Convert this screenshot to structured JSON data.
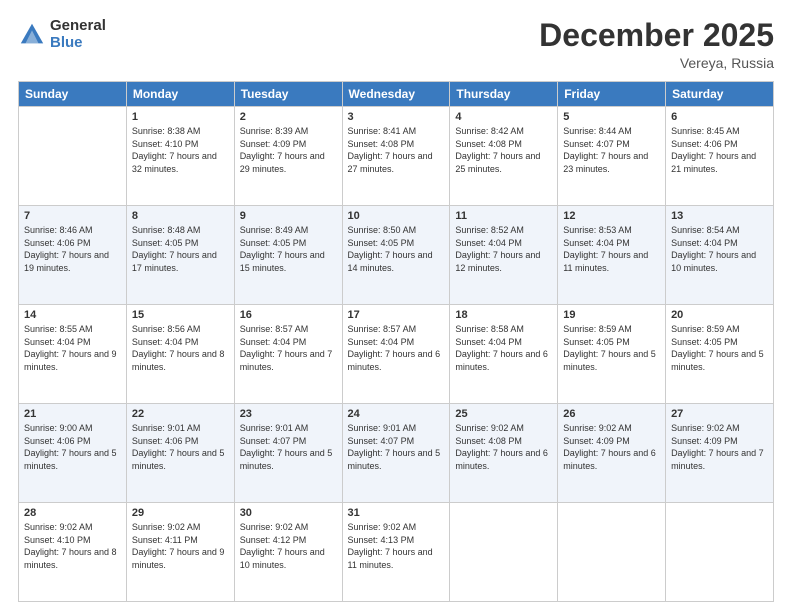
{
  "logo": {
    "general": "General",
    "blue": "Blue"
  },
  "title": "December 2025",
  "location": "Vereya, Russia",
  "days_header": [
    "Sunday",
    "Monday",
    "Tuesday",
    "Wednesday",
    "Thursday",
    "Friday",
    "Saturday"
  ],
  "weeks": [
    [
      {
        "num": "",
        "sunrise": "",
        "sunset": "",
        "daylight": ""
      },
      {
        "num": "1",
        "sunrise": "Sunrise: 8:38 AM",
        "sunset": "Sunset: 4:10 PM",
        "daylight": "Daylight: 7 hours and 32 minutes."
      },
      {
        "num": "2",
        "sunrise": "Sunrise: 8:39 AM",
        "sunset": "Sunset: 4:09 PM",
        "daylight": "Daylight: 7 hours and 29 minutes."
      },
      {
        "num": "3",
        "sunrise": "Sunrise: 8:41 AM",
        "sunset": "Sunset: 4:08 PM",
        "daylight": "Daylight: 7 hours and 27 minutes."
      },
      {
        "num": "4",
        "sunrise": "Sunrise: 8:42 AM",
        "sunset": "Sunset: 4:08 PM",
        "daylight": "Daylight: 7 hours and 25 minutes."
      },
      {
        "num": "5",
        "sunrise": "Sunrise: 8:44 AM",
        "sunset": "Sunset: 4:07 PM",
        "daylight": "Daylight: 7 hours and 23 minutes."
      },
      {
        "num": "6",
        "sunrise": "Sunrise: 8:45 AM",
        "sunset": "Sunset: 4:06 PM",
        "daylight": "Daylight: 7 hours and 21 minutes."
      }
    ],
    [
      {
        "num": "7",
        "sunrise": "Sunrise: 8:46 AM",
        "sunset": "Sunset: 4:06 PM",
        "daylight": "Daylight: 7 hours and 19 minutes."
      },
      {
        "num": "8",
        "sunrise": "Sunrise: 8:48 AM",
        "sunset": "Sunset: 4:05 PM",
        "daylight": "Daylight: 7 hours and 17 minutes."
      },
      {
        "num": "9",
        "sunrise": "Sunrise: 8:49 AM",
        "sunset": "Sunset: 4:05 PM",
        "daylight": "Daylight: 7 hours and 15 minutes."
      },
      {
        "num": "10",
        "sunrise": "Sunrise: 8:50 AM",
        "sunset": "Sunset: 4:05 PM",
        "daylight": "Daylight: 7 hours and 14 minutes."
      },
      {
        "num": "11",
        "sunrise": "Sunrise: 8:52 AM",
        "sunset": "Sunset: 4:04 PM",
        "daylight": "Daylight: 7 hours and 12 minutes."
      },
      {
        "num": "12",
        "sunrise": "Sunrise: 8:53 AM",
        "sunset": "Sunset: 4:04 PM",
        "daylight": "Daylight: 7 hours and 11 minutes."
      },
      {
        "num": "13",
        "sunrise": "Sunrise: 8:54 AM",
        "sunset": "Sunset: 4:04 PM",
        "daylight": "Daylight: 7 hours and 10 minutes."
      }
    ],
    [
      {
        "num": "14",
        "sunrise": "Sunrise: 8:55 AM",
        "sunset": "Sunset: 4:04 PM",
        "daylight": "Daylight: 7 hours and 9 minutes."
      },
      {
        "num": "15",
        "sunrise": "Sunrise: 8:56 AM",
        "sunset": "Sunset: 4:04 PM",
        "daylight": "Daylight: 7 hours and 8 minutes."
      },
      {
        "num": "16",
        "sunrise": "Sunrise: 8:57 AM",
        "sunset": "Sunset: 4:04 PM",
        "daylight": "Daylight: 7 hours and 7 minutes."
      },
      {
        "num": "17",
        "sunrise": "Sunrise: 8:57 AM",
        "sunset": "Sunset: 4:04 PM",
        "daylight": "Daylight: 7 hours and 6 minutes."
      },
      {
        "num": "18",
        "sunrise": "Sunrise: 8:58 AM",
        "sunset": "Sunset: 4:04 PM",
        "daylight": "Daylight: 7 hours and 6 minutes."
      },
      {
        "num": "19",
        "sunrise": "Sunrise: 8:59 AM",
        "sunset": "Sunset: 4:05 PM",
        "daylight": "Daylight: 7 hours and 5 minutes."
      },
      {
        "num": "20",
        "sunrise": "Sunrise: 8:59 AM",
        "sunset": "Sunset: 4:05 PM",
        "daylight": "Daylight: 7 hours and 5 minutes."
      }
    ],
    [
      {
        "num": "21",
        "sunrise": "Sunrise: 9:00 AM",
        "sunset": "Sunset: 4:06 PM",
        "daylight": "Daylight: 7 hours and 5 minutes."
      },
      {
        "num": "22",
        "sunrise": "Sunrise: 9:01 AM",
        "sunset": "Sunset: 4:06 PM",
        "daylight": "Daylight: 7 hours and 5 minutes."
      },
      {
        "num": "23",
        "sunrise": "Sunrise: 9:01 AM",
        "sunset": "Sunset: 4:07 PM",
        "daylight": "Daylight: 7 hours and 5 minutes."
      },
      {
        "num": "24",
        "sunrise": "Sunrise: 9:01 AM",
        "sunset": "Sunset: 4:07 PM",
        "daylight": "Daylight: 7 hours and 5 minutes."
      },
      {
        "num": "25",
        "sunrise": "Sunrise: 9:02 AM",
        "sunset": "Sunset: 4:08 PM",
        "daylight": "Daylight: 7 hours and 6 minutes."
      },
      {
        "num": "26",
        "sunrise": "Sunrise: 9:02 AM",
        "sunset": "Sunset: 4:09 PM",
        "daylight": "Daylight: 7 hours and 6 minutes."
      },
      {
        "num": "27",
        "sunrise": "Sunrise: 9:02 AM",
        "sunset": "Sunset: 4:09 PM",
        "daylight": "Daylight: 7 hours and 7 minutes."
      }
    ],
    [
      {
        "num": "28",
        "sunrise": "Sunrise: 9:02 AM",
        "sunset": "Sunset: 4:10 PM",
        "daylight": "Daylight: 7 hours and 8 minutes."
      },
      {
        "num": "29",
        "sunrise": "Sunrise: 9:02 AM",
        "sunset": "Sunset: 4:11 PM",
        "daylight": "Daylight: 7 hours and 9 minutes."
      },
      {
        "num": "30",
        "sunrise": "Sunrise: 9:02 AM",
        "sunset": "Sunset: 4:12 PM",
        "daylight": "Daylight: 7 hours and 10 minutes."
      },
      {
        "num": "31",
        "sunrise": "Sunrise: 9:02 AM",
        "sunset": "Sunset: 4:13 PM",
        "daylight": "Daylight: 7 hours and 11 minutes."
      },
      {
        "num": "",
        "sunrise": "",
        "sunset": "",
        "daylight": ""
      },
      {
        "num": "",
        "sunrise": "",
        "sunset": "",
        "daylight": ""
      },
      {
        "num": "",
        "sunrise": "",
        "sunset": "",
        "daylight": ""
      }
    ]
  ]
}
